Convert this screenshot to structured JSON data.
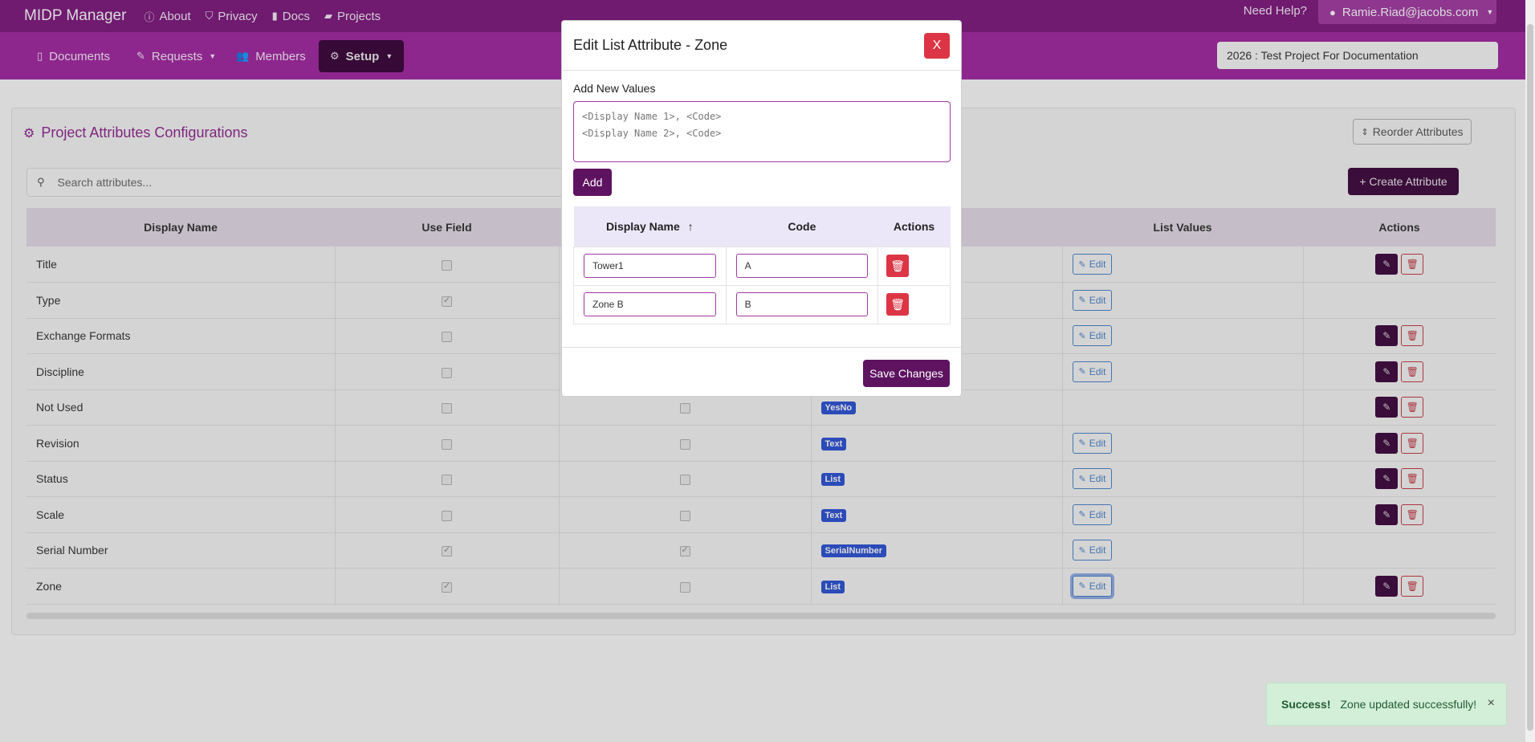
{
  "app": {
    "brand": "MIDP Manager",
    "links": [
      {
        "label": "About",
        "icon": "info-icon"
      },
      {
        "label": "Privacy",
        "icon": "shield-icon"
      },
      {
        "label": "Docs",
        "icon": "book-icon"
      },
      {
        "label": "Projects",
        "icon": "folder-icon"
      }
    ],
    "help": "Need Help?",
    "user": "Ramie.Riad@jacobs.com"
  },
  "nav": {
    "items": [
      {
        "label": "Documents",
        "icon": "file-icon"
      },
      {
        "label": "Requests",
        "icon": "edit-square-icon"
      },
      {
        "label": "Members",
        "icon": "users-icon"
      },
      {
        "label": "Setup",
        "icon": "gear-icon"
      }
    ],
    "project": "2026 : Test Project For Documentation"
  },
  "card": {
    "title": "Project Attributes Configurations",
    "reorder": "Reorder Attributes",
    "search_placeholder": "Search attributes...",
    "create": "+ Create Attribute",
    "columns": [
      "Display Name",
      "Use Field",
      "",
      "",
      "List Values",
      "Actions"
    ],
    "rows": [
      {
        "name": "Title",
        "use": false,
        "req": null,
        "type": null,
        "edit": true,
        "actions": true
      },
      {
        "name": "Type",
        "use": true,
        "req": null,
        "type": null,
        "edit": true,
        "actions": false
      },
      {
        "name": "Exchange Formats",
        "use": false,
        "req": null,
        "type": null,
        "edit": true,
        "actions": true
      },
      {
        "name": "Discipline",
        "use": false,
        "req": null,
        "type": null,
        "edit": true,
        "actions": true
      },
      {
        "name": "Not Used",
        "use": false,
        "req": false,
        "type": "YesNo",
        "edit": false,
        "actions": true
      },
      {
        "name": "Revision",
        "use": false,
        "req": false,
        "type": "Text",
        "edit": true,
        "actions": true
      },
      {
        "name": "Status",
        "use": false,
        "req": false,
        "type": "List",
        "edit": true,
        "actions": true
      },
      {
        "name": "Scale",
        "use": false,
        "req": false,
        "type": "Text",
        "edit": true,
        "actions": true
      },
      {
        "name": "Serial Number",
        "use": true,
        "req": true,
        "type": "SerialNumber",
        "edit": true,
        "actions": false
      },
      {
        "name": "Zone",
        "use": true,
        "req": false,
        "type": "List",
        "edit": true,
        "actions": true
      }
    ],
    "edit_label": "Edit"
  },
  "modal": {
    "title": "Edit List Attribute - Zone",
    "close": "X",
    "add_label": "Add New Values",
    "placeholder_line1": "<Display Name 1>, <Code>",
    "placeholder_line2": "<Display Name 2>, <Code>",
    "add_button": "Add",
    "columns": {
      "name": "Display Name",
      "code": "Code",
      "actions": "Actions"
    },
    "values": [
      {
        "name": "Tower1",
        "code": "A"
      },
      {
        "name": "Zone B",
        "code": "B"
      }
    ],
    "save": "Save Changes"
  },
  "toast": {
    "strong": "Success!",
    "message": "Zone updated successfully!",
    "close": "×"
  },
  "colors": {
    "brand": "#7a1d7a",
    "nav": "#9a2b9a",
    "primary": "#5e1360",
    "danger": "#dc3545",
    "badge": "#2f52c9",
    "success_bg": "#d3efd8"
  }
}
